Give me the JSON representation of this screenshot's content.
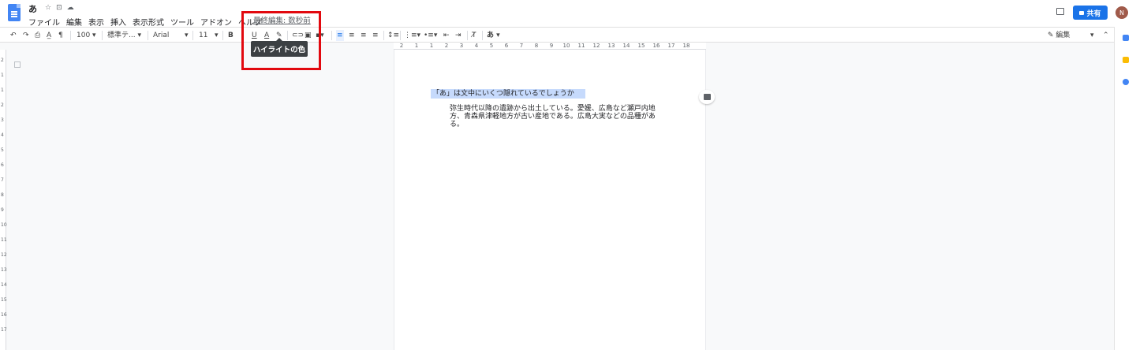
{
  "doc": {
    "title": "あ",
    "title_icons": [
      "☆",
      "⊡",
      "☁"
    ]
  },
  "menu": [
    "ファイル",
    "編集",
    "表示",
    "挿入",
    "表示形式",
    "ツール",
    "アドオン",
    "ヘルプ"
  ],
  "last_edit": "最終編集: 数秒前",
  "share": {
    "label": "共有",
    "icon": "lock-icon"
  },
  "avatar": "N",
  "toolbar": {
    "zoom": "100",
    "style": "標準テ...",
    "font": "Arial",
    "size": "11",
    "bold": "B",
    "underline": "U",
    "text_color": "A",
    "input_tool": "あ",
    "edit_mode": "編集"
  },
  "tooltip": "ハイライトの色",
  "ruler_h": [
    "2",
    "1",
    "1",
    "2",
    "3",
    "4",
    "5",
    "6",
    "7",
    "8",
    "9",
    "10",
    "11",
    "12",
    "13",
    "14",
    "15",
    "16",
    "17",
    "18"
  ],
  "ruler_v": [
    "2",
    "1",
    "1",
    "2",
    "3",
    "4",
    "5",
    "6",
    "7",
    "8",
    "9",
    "10",
    "11",
    "12",
    "13",
    "14",
    "15",
    "16",
    "17"
  ],
  "content": {
    "heading": "「あ」は文中にいくつ隠れているでしょうか",
    "paragraph": "弥生時代以降の遺跡から出土している。愛媛、広島など瀬戸内地方、青森県津軽地方が古い産地である。広島大実などの品種がある。"
  },
  "colors": {
    "accent": "#1a73e8",
    "highlight": "#c6dafc",
    "annotation": "#e2090f",
    "tooltip_bg": "#3c4043"
  }
}
